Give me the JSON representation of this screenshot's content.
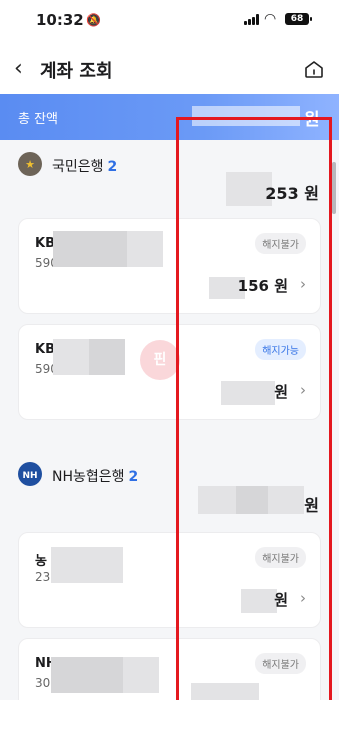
{
  "status_bar": {
    "time": "10:32",
    "battery": "68"
  },
  "header": {
    "back_icon": "chevron-left-icon",
    "title": "계좌 조회",
    "home_icon": "home-icon"
  },
  "total": {
    "label": "총 잔액",
    "unit": "원"
  },
  "banks": [
    {
      "name": "국민은행",
      "count": "2",
      "total_suffix": "253 원",
      "accounts": [
        {
          "name_prefix": "KB",
          "number_prefix": "590",
          "badge": "해지불가",
          "badge_state": "neutral",
          "amount_suffix": "156 원"
        },
        {
          "name_prefix": "KB",
          "number_prefix": "590",
          "badge": "해지가능",
          "badge_state": "active",
          "amount_suffix": "원"
        }
      ]
    },
    {
      "name": "NH농협은행",
      "count": "2",
      "total_suffix": "원",
      "accounts": [
        {
          "name_prefix": "농",
          "number_prefix": "23",
          "badge": "해지불가",
          "badge_state": "neutral",
          "amount_suffix": "원"
        },
        {
          "name_prefix": "NH",
          "number_prefix": "30",
          "badge": "해지불가",
          "badge_state": "neutral",
          "amount_suffix": ""
        }
      ]
    }
  ],
  "watermark": "핀",
  "bank_icon_labels": {
    "nh": "NH"
  },
  "colors": {
    "accent": "#2f6fe4",
    "highlight_box": "#e4181f",
    "total_bar": "#5a8cf2"
  }
}
